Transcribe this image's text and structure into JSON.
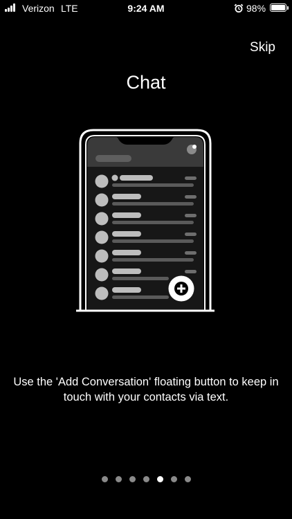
{
  "status_bar": {
    "carrier": "Verizon",
    "network": "LTE",
    "time": "9:24 AM",
    "battery_percent": "98%",
    "battery_level": 0.98,
    "icons": [
      "signal-icon",
      "alarm-icon",
      "battery-icon"
    ]
  },
  "header": {
    "skip_label": "Skip"
  },
  "slide": {
    "title": "Chat",
    "description": "Use the 'Add Conversation' floating button to keep in touch with your contacts via text.",
    "illustration_icon": "phone-chat-list-illustration",
    "fab_icon": "add-conversation-icon"
  },
  "pagination": {
    "total": 7,
    "active_index": 4
  },
  "colors": {
    "background": "#000000",
    "text": "#ffffff",
    "dot_inactive": "#8a8a8a",
    "dot_active": "#ffffff"
  }
}
